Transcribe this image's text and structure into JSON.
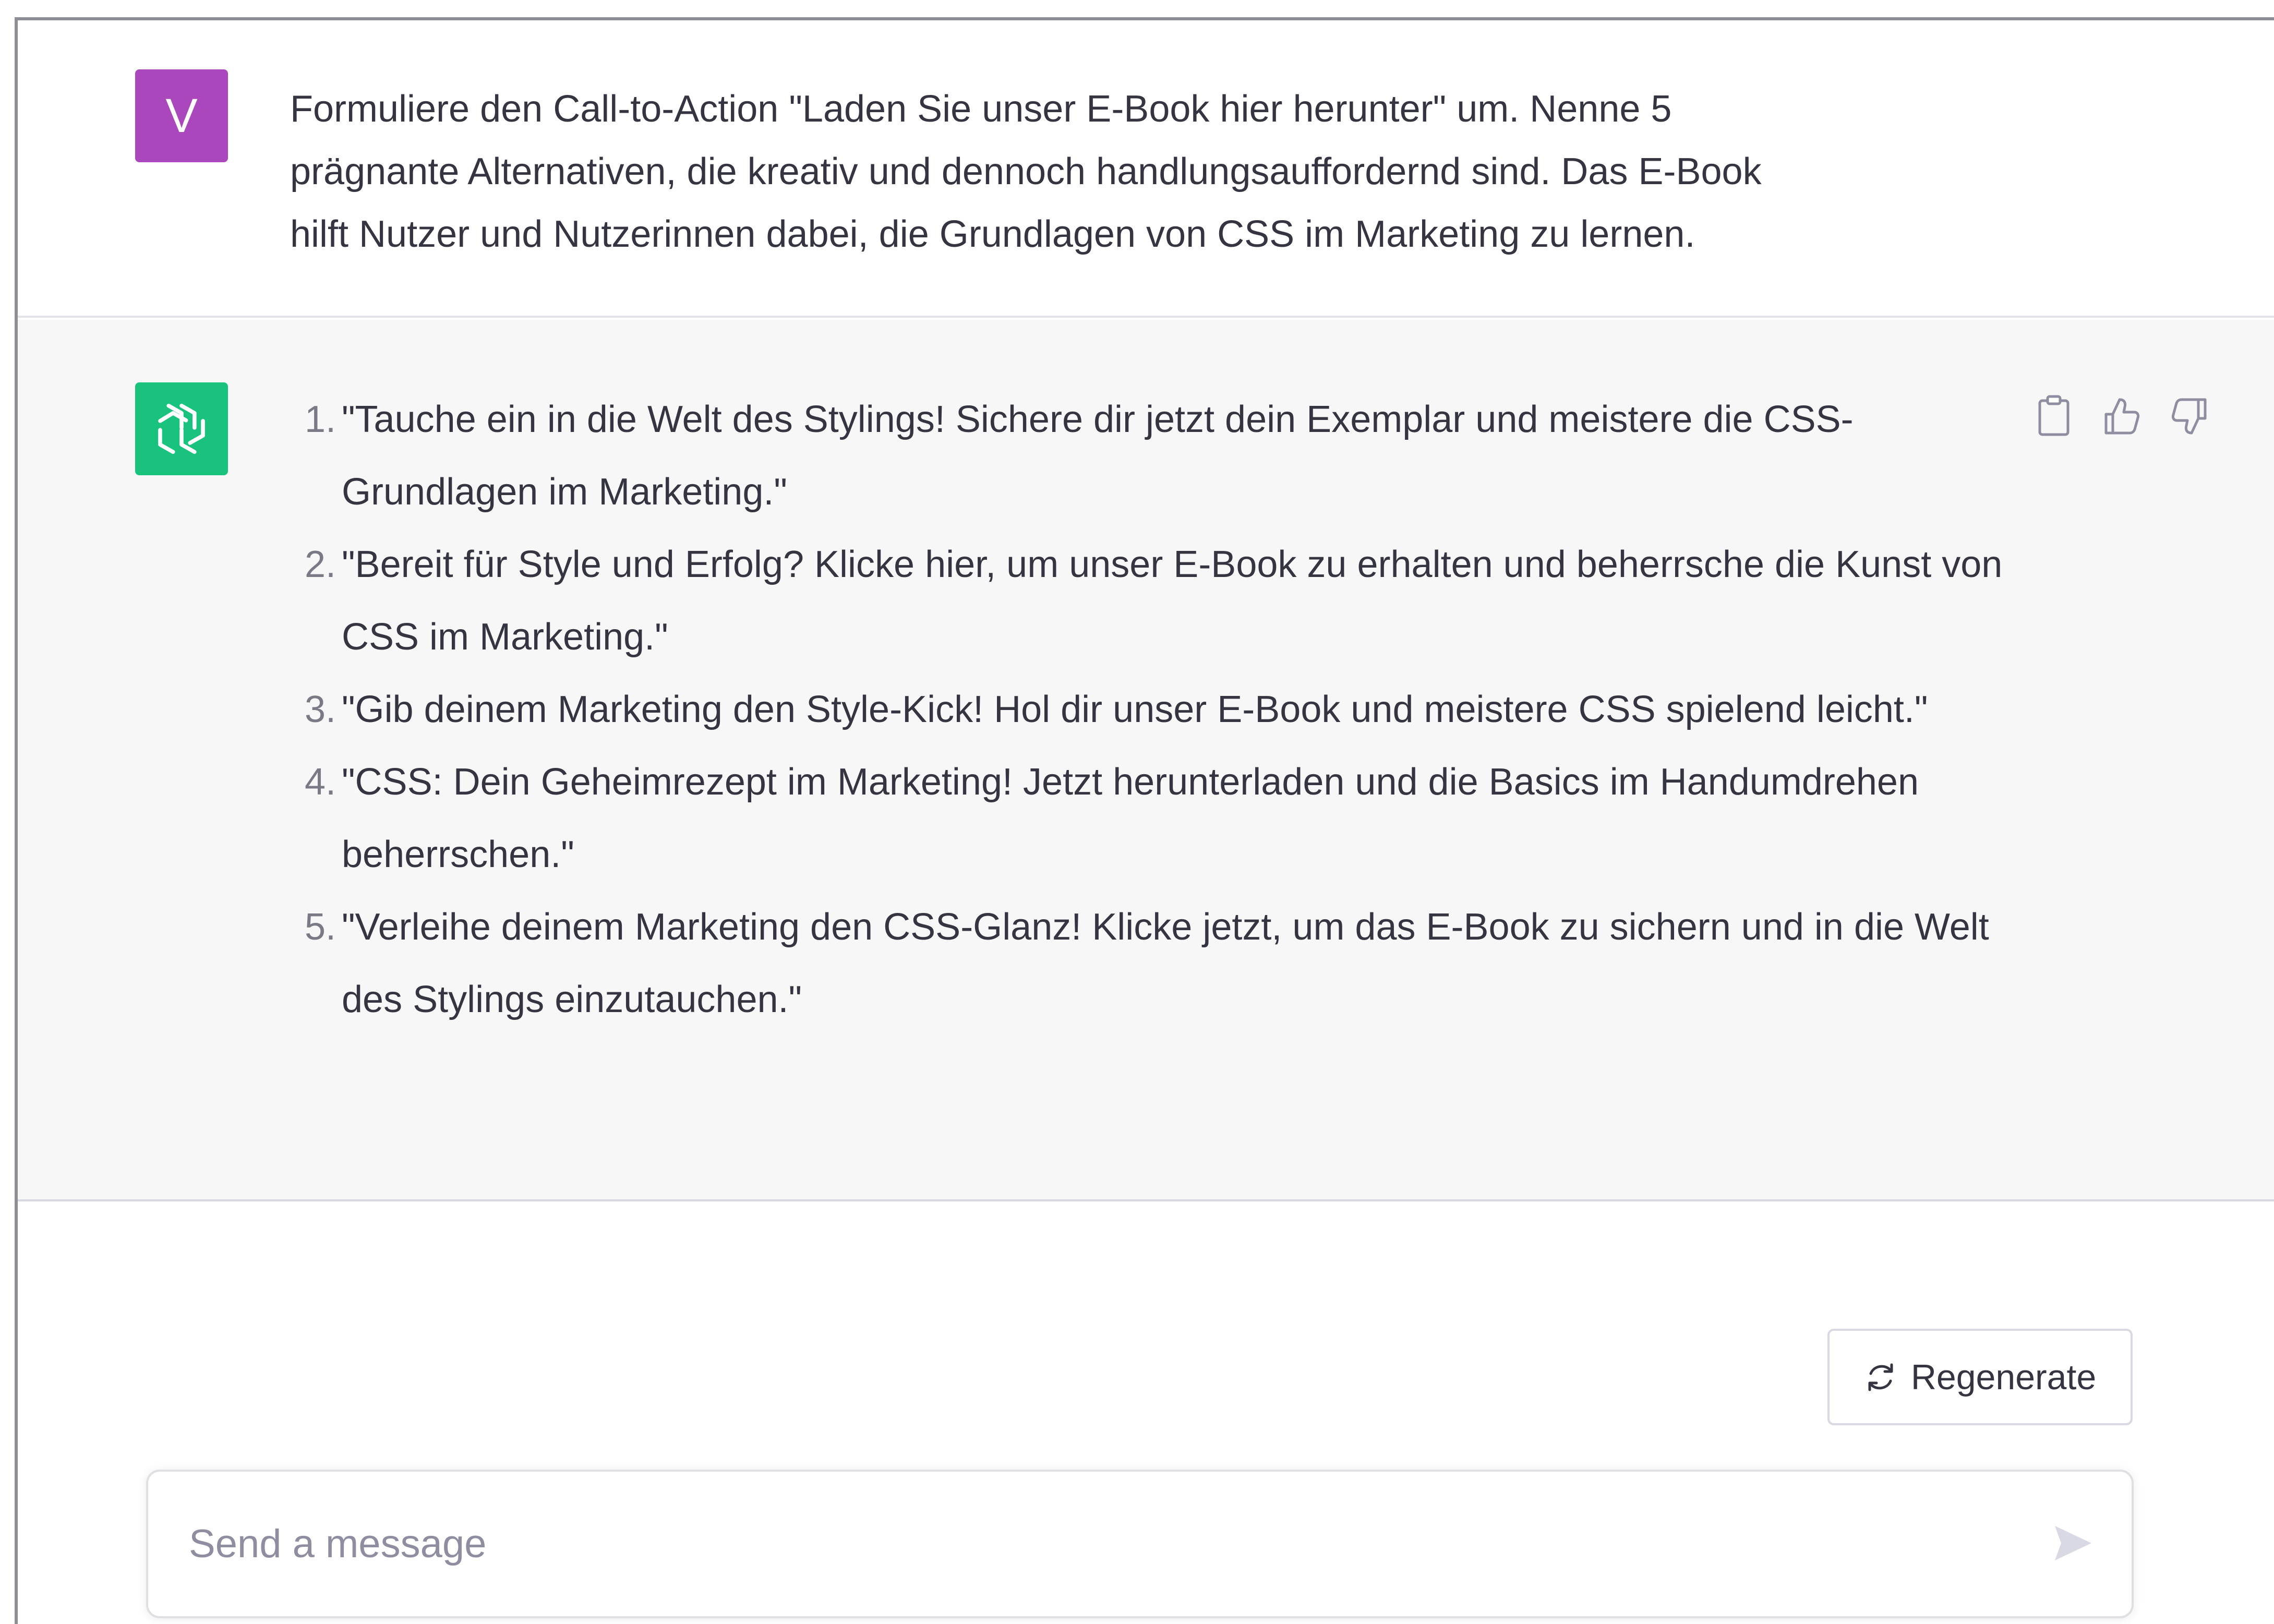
{
  "conversation": {
    "user": {
      "avatar_letter": "V",
      "avatar_color": "#ab47bc",
      "lines": [
        "Formuliere den Call-to-Action \"Laden Sie unser E-Book hier herunter\" um. Nenne 5",
        "prägnante Alternativen, die kreativ und dennoch handlungsauffordernd sind. Das E-Book",
        "hilft Nutzer und Nutzerinnen dabei, die Grundlagen von CSS im Marketing zu lernen."
      ]
    },
    "assistant": {
      "avatar_color": "#19c37d",
      "answers": [
        {
          "number": "1.",
          "text": "\"Tauche ein in die Welt des Stylings! Sichere dir jetzt dein Exemplar und meistere die CSS-Grundlagen im Marketing.\""
        },
        {
          "number": "2.",
          "text": "\"Bereit für Style und Erfolg? Klicke hier, um unser E-Book zu erhalten und beherrsche die Kunst von CSS im Marketing.\""
        },
        {
          "number": "3.",
          "text": "\"Gib deinem Marketing den Style-Kick! Hol dir unser E-Book und meistere CSS spielend leicht.\""
        },
        {
          "number": "4.",
          "text": "\"CSS: Dein Geheimrezept im Marketing! Jetzt herunterladen und die Basics im Handumdrehen beherrschen.\""
        },
        {
          "number": "5.",
          "text": "\"Verleihe deinem Marketing den CSS-Glanz! Klicke jetzt, um das E-Book zu sichern und in die Welt des Stylings einzutauchen.\""
        }
      ],
      "actions": {
        "copy_icon": "clipboard-icon",
        "like_icon": "thumbs-up-icon",
        "dislike_icon": "thumbs-down-icon"
      }
    }
  },
  "controls": {
    "regenerate_label": "Regenerate",
    "regenerate_icon": "refresh-icon"
  },
  "composer": {
    "placeholder": "Send a message",
    "value": "",
    "send_icon": "send-icon"
  },
  "colors": {
    "text": "#343541",
    "assistant_background": "#f7f7f8",
    "border": "#d9d9e3"
  }
}
